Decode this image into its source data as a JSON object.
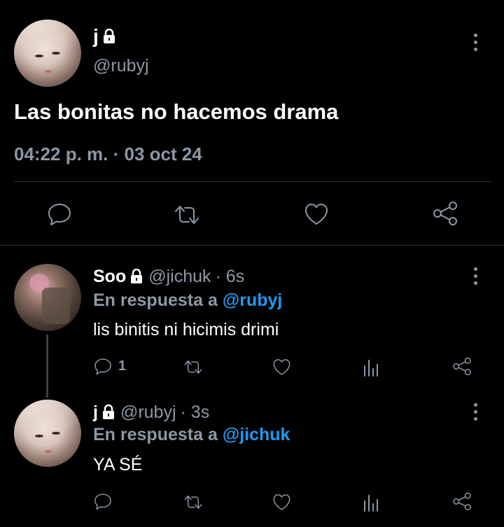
{
  "main_tweet": {
    "display_name": "j",
    "handle": "@rubyj",
    "text": "Las bonitas no hacemos drama",
    "timestamp": "04:22 p. m. · 03 oct 24"
  },
  "replies": [
    {
      "display_name": "Soo",
      "handle": "@jichuk",
      "time": "· 6s",
      "reply_prefix": "En respuesta a",
      "reply_to": "@rubyj",
      "text": "lis binitis ni hicimis drimi",
      "reply_count": "1"
    },
    {
      "display_name": "j",
      "handle": "@rubyj",
      "time": "· 3s",
      "reply_prefix": "En respuesta a",
      "reply_to": "@jichuk",
      "text": "YA SÉ",
      "reply_count": ""
    }
  ],
  "colors": {
    "background": "#000000",
    "text": "#ffffff",
    "muted": "#8b98a5",
    "link": "#1d9bf0",
    "divider": "#2f3336"
  }
}
